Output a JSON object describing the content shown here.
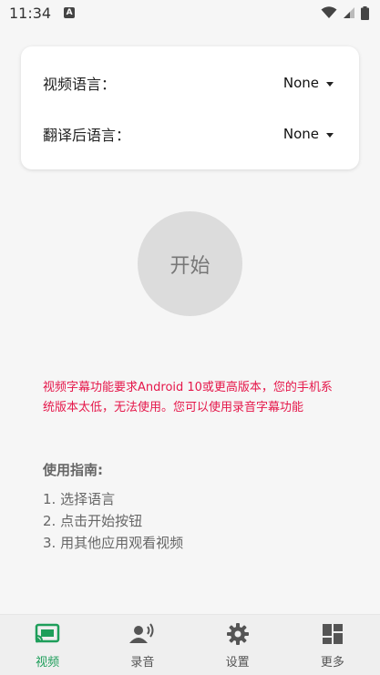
{
  "status_bar": {
    "time": "11:34",
    "notification_badge": "A"
  },
  "settings_card": {
    "video_language_label": "视频语言：",
    "video_language_value": "None",
    "translate_language_label": "翻译后语言：",
    "translate_language_value": "None"
  },
  "start_button_label": "开始",
  "warning_text": "视频字幕功能要求Android 10或更高版本，您的手机系统版本太低，无法使用。您可以使用录音字幕功能",
  "guide": {
    "title": "使用指南:",
    "steps": [
      "1. 选择语言",
      "2. 点击开始按钮",
      "3. 用其他应用观看视频"
    ]
  },
  "bottom_nav": [
    {
      "label": "视频",
      "icon": "cast-icon",
      "active": true
    },
    {
      "label": "录音",
      "icon": "voice-icon",
      "active": false
    },
    {
      "label": "设置",
      "icon": "gear-icon",
      "active": false
    },
    {
      "label": "更多",
      "icon": "dashboard-icon",
      "active": false
    }
  ],
  "colors": {
    "accent": "#1e9e5a",
    "warning": "#e5174a"
  }
}
